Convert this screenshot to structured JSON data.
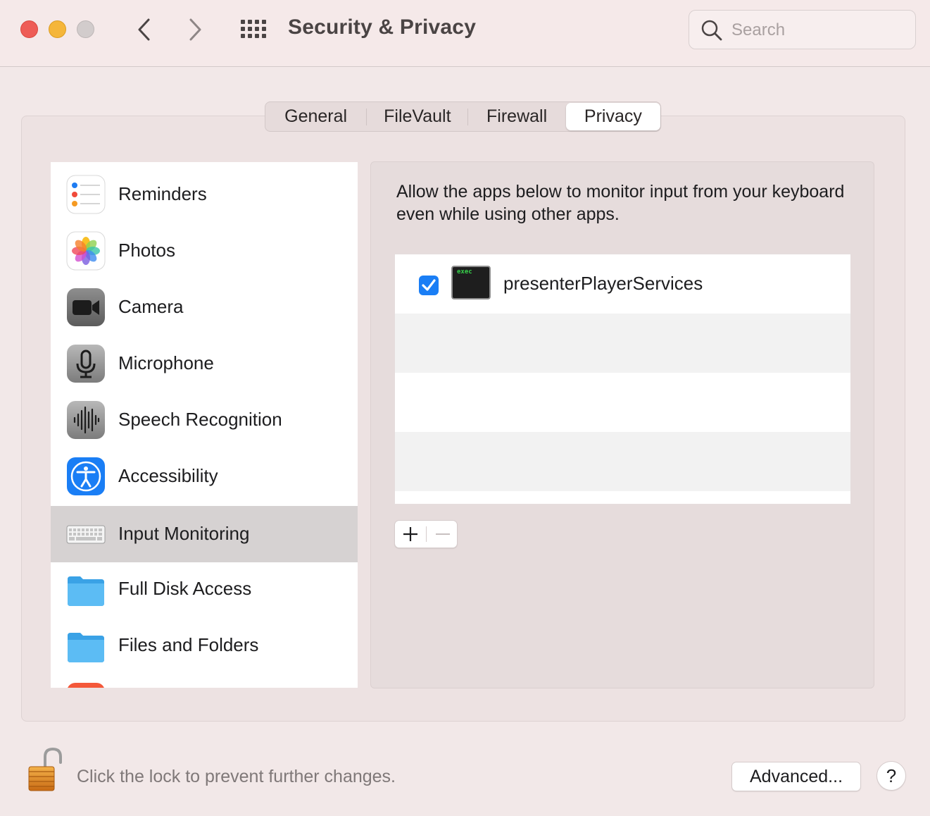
{
  "window": {
    "title": "Security & Privacy",
    "search_placeholder": "Search"
  },
  "tabs": [
    {
      "label": "General",
      "selected": false
    },
    {
      "label": "FileVault",
      "selected": false
    },
    {
      "label": "Firewall",
      "selected": false
    },
    {
      "label": "Privacy",
      "selected": true
    }
  ],
  "sidebar": {
    "items": [
      {
        "label": "Reminders",
        "icon": "reminders-icon",
        "selected": false
      },
      {
        "label": "Photos",
        "icon": "photos-icon",
        "selected": false
      },
      {
        "label": "Camera",
        "icon": "camera-icon",
        "selected": false
      },
      {
        "label": "Microphone",
        "icon": "microphone-icon",
        "selected": false
      },
      {
        "label": "Speech Recognition",
        "icon": "speech-recognition-icon",
        "selected": false
      },
      {
        "label": "Accessibility",
        "icon": "accessibility-icon",
        "selected": false
      },
      {
        "label": "Input Monitoring",
        "icon": "keyboard-icon",
        "selected": true
      },
      {
        "label": "Full Disk Access",
        "icon": "folder-icon",
        "selected": false
      },
      {
        "label": "Files and Folders",
        "icon": "folder-icon",
        "selected": false
      }
    ]
  },
  "main": {
    "description": "Allow the apps below to monitor input from your keyboard even while using other apps.",
    "apps": [
      {
        "name": "presenterPlayerServices",
        "checked": true,
        "icon_text": "exec"
      }
    ],
    "add_label": "+",
    "remove_label": "—"
  },
  "footer": {
    "lock_text": "Click the lock to prevent further changes.",
    "advanced_label": "Advanced...",
    "help_label": "?"
  },
  "colors": {
    "accent": "#1a7ef5",
    "close": "#ee5c56",
    "minimize": "#f5b63a",
    "zoom_disabled": "#d2cccc"
  }
}
